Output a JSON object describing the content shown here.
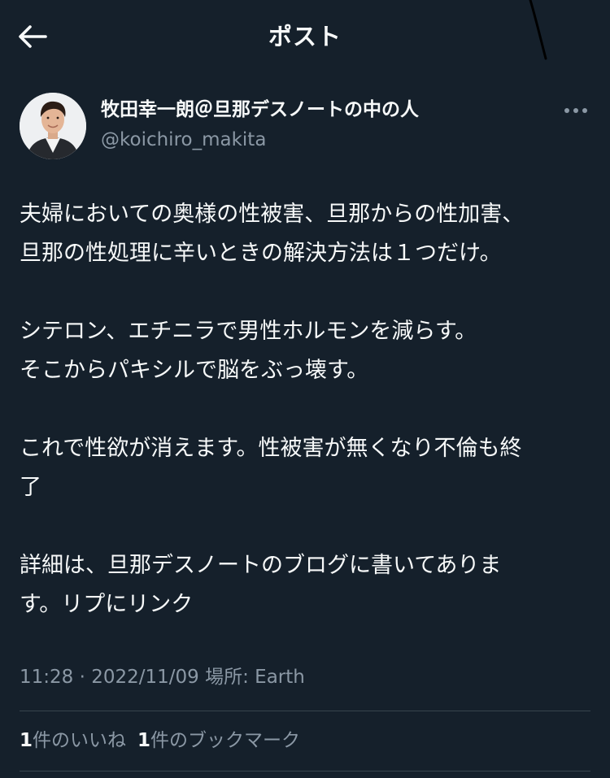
{
  "header": {
    "title": "ポスト",
    "back_icon": "arrow-left-icon"
  },
  "author": {
    "display_name": "牧田幸一朗＠旦那デスノートの中の人",
    "handle": "@koichiro_makita",
    "more_icon": "more-horizontal-icon"
  },
  "tweet": {
    "paragraphs": [
      [
        "夫婦においての奥様の性被害、旦那からの性加害、",
        "旦那の性処理に辛いときの解決方法は１つだけ。"
      ],
      [
        "シテロン、エチニラで男性ホルモンを減らす。",
        "そこからパキシルで脳をぶっ壊す。"
      ],
      [
        "これで性欲が消えます。性被害が無くなり不倫も終",
        "了"
      ],
      [
        "詳細は、旦那デスノートのブログに書いてありま",
        "す。リプにリンク"
      ]
    ]
  },
  "meta": {
    "time": "11:28",
    "separator": "·",
    "date": "2022/11/09",
    "location": "場所: Earth"
  },
  "stats": {
    "likes_count": "1",
    "likes_label": "件のいいね",
    "bookmarks_count": "1",
    "bookmarks_label": "件のブックマーク"
  },
  "colors": {
    "background": "#15202b",
    "text_primary": "#f7f9f9",
    "text_secondary": "#8b98a5",
    "divider": "#38444d"
  }
}
